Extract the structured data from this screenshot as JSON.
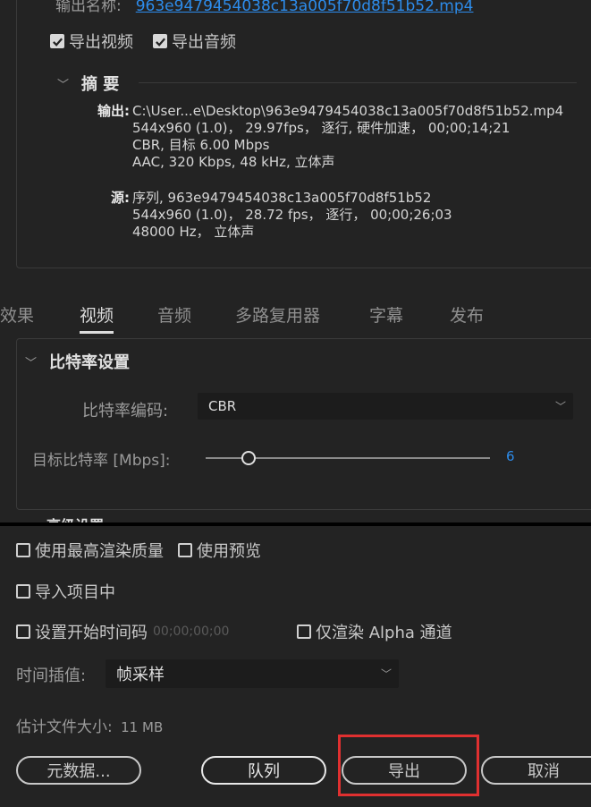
{
  "output_name": {
    "label": "输出名称:",
    "value": "963e9479454038c13a005f70d8f51b52.mp4"
  },
  "export_video": {
    "label": "导出视频",
    "checked": true
  },
  "export_audio": {
    "label": "导出音频",
    "checked": true
  },
  "summary": {
    "title": "摘 要",
    "output_label": "输出:",
    "output_lines": [
      "C:\\User...e\\Desktop\\963e9479454038c13a005f70d8f51b52.mp4",
      "544x960 (1.0)， 29.97fps， 逐行, 硬件加速， 00;00;14;21",
      "CBR, 目标 6.00 Mbps",
      "AAC, 320 Kbps, 48  kHz, 立体声"
    ],
    "source_label": "源:",
    "source_lines": [
      "序列, 963e9479454038c13a005f70d8f51b52",
      "544x960 (1.0)， 28.72 fps， 逐行， 00;00;26;03",
      "48000 Hz， 立体声"
    ]
  },
  "tabs": [
    {
      "label": "效果",
      "active": false
    },
    {
      "label": "视频",
      "active": true
    },
    {
      "label": "音频",
      "active": false
    },
    {
      "label": "多路复用器",
      "active": false
    },
    {
      "label": "字幕",
      "active": false
    },
    {
      "label": "发布",
      "active": false
    }
  ],
  "bitrate": {
    "title": "比特率设置",
    "encoding_label": "比特率编码:",
    "encoding_value": "CBR",
    "target_label": "目标比特率 [Mbps]:",
    "target_value": "6",
    "target_fraction": 0.15,
    "next_section_title": "高级设置"
  },
  "options": {
    "max_render_quality": {
      "label": "使用最高渲染质量",
      "checked": false
    },
    "use_previews": {
      "label": "使用预览",
      "checked": false
    },
    "import_into_project": {
      "label": "导入项目中",
      "checked": false
    },
    "set_start_timecode": {
      "label": "设置开始时间码",
      "checked": false,
      "timecode": "00;00;00;00"
    },
    "render_alpha_only": {
      "label": "仅渲染 Alpha 通道",
      "checked": false
    }
  },
  "time_interpolation": {
    "label": "时间插值:",
    "value": "帧采样"
  },
  "estimated_size": {
    "label": "估计文件大小:",
    "value": "11 MB"
  },
  "buttons": {
    "metadata": "元数据...",
    "queue": "队列",
    "export": "导出",
    "cancel": "取消"
  },
  "colors": {
    "background": "#232323",
    "link": "#2d8ceb",
    "highlight": "#e03030"
  }
}
